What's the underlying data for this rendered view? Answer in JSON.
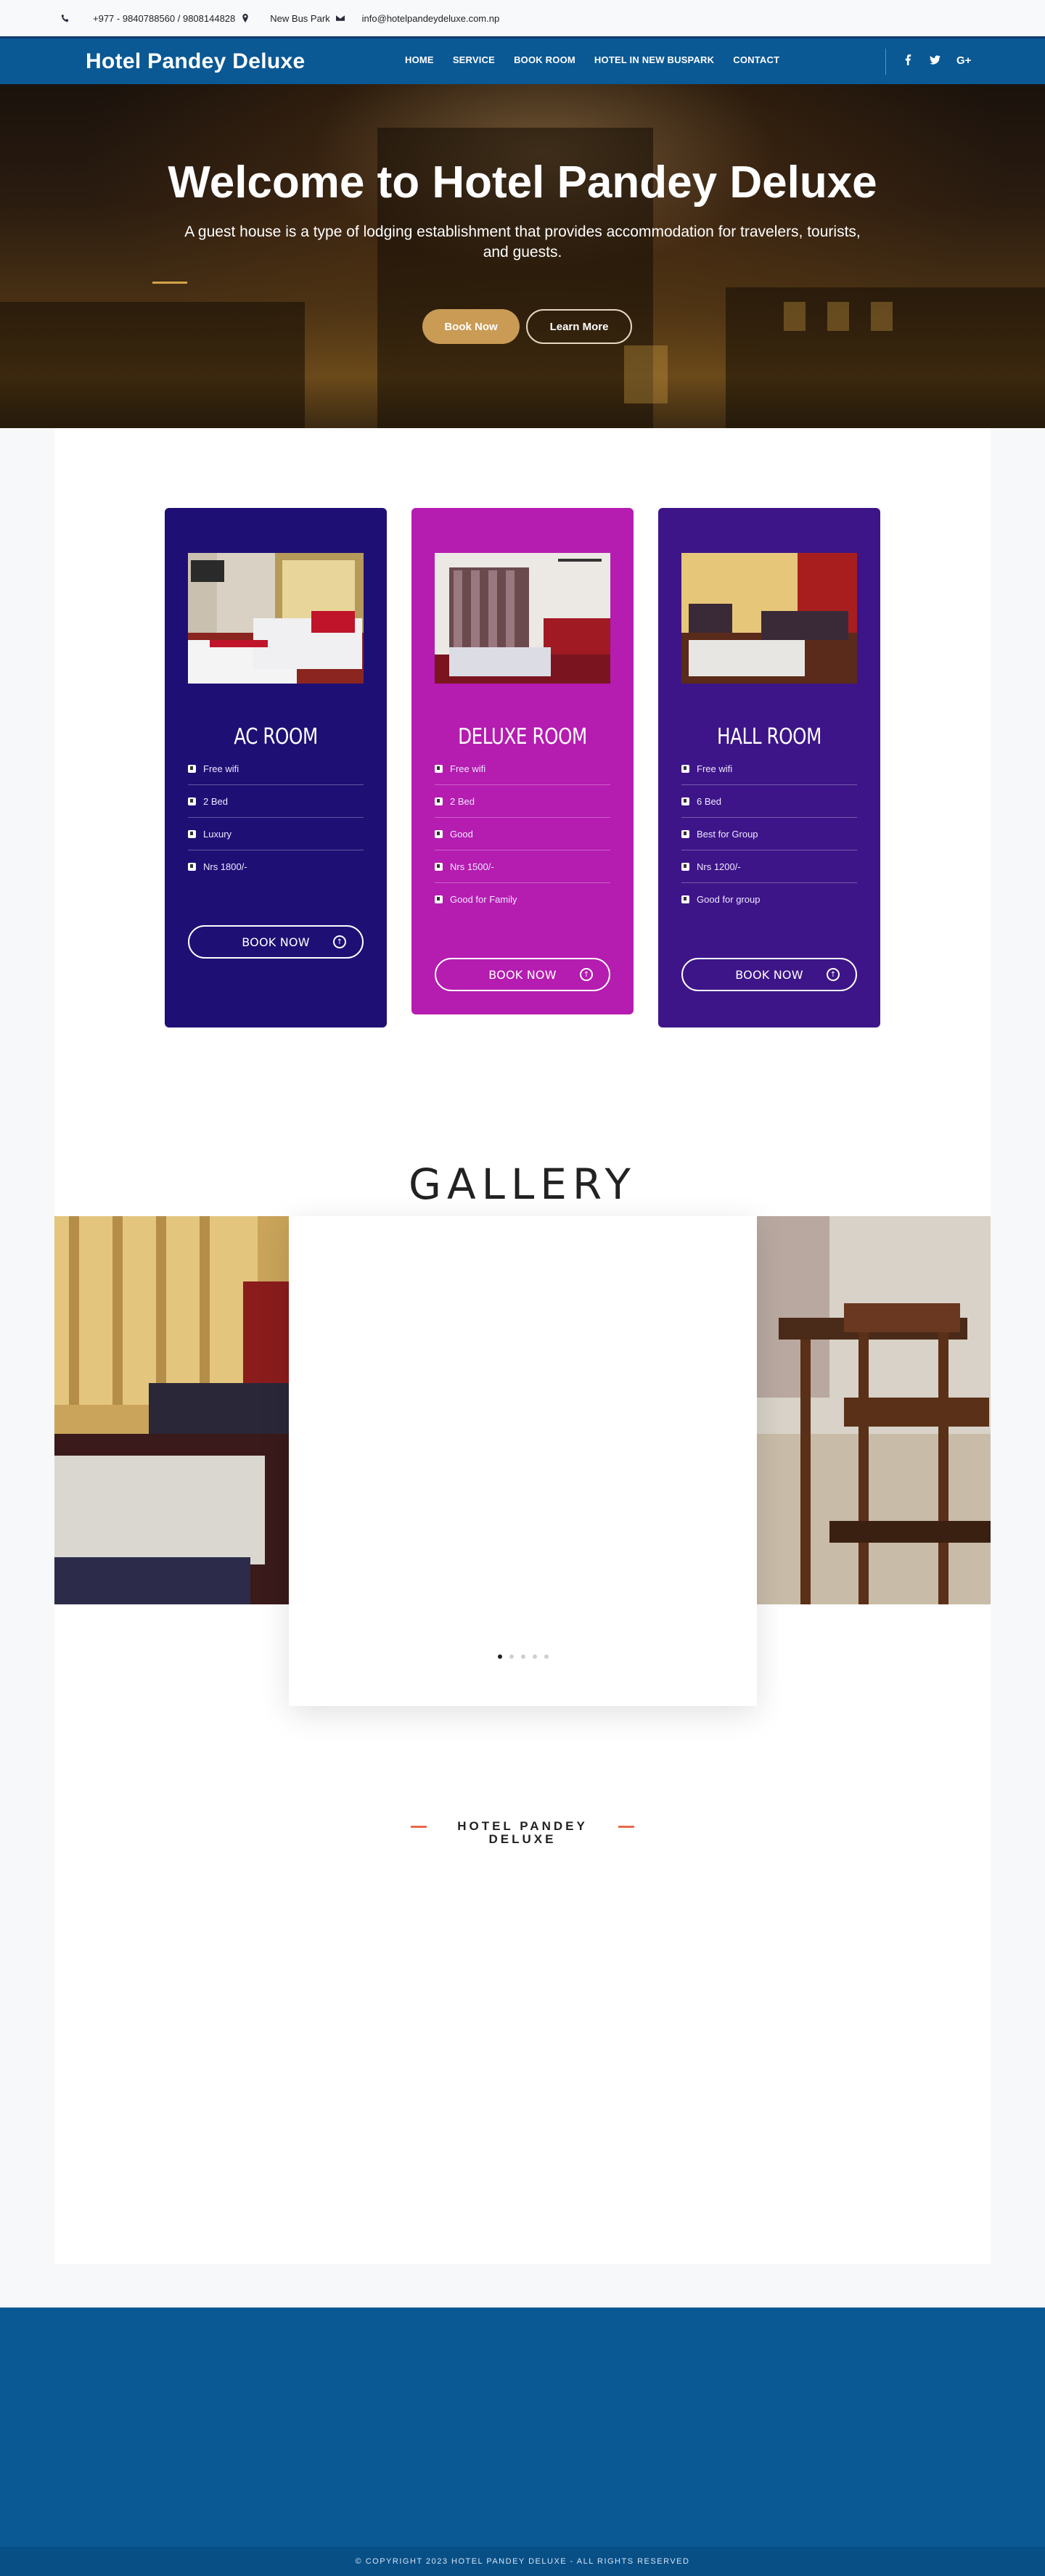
{
  "topbar": {
    "phone": "+977 - 9840788560 / 9808144828",
    "location": "New Bus Park",
    "email": "info@hotelpandeydeluxe.com.np"
  },
  "nav": {
    "brand": "Hotel Pandey Deluxe",
    "items": [
      "HOME",
      "SERVICE",
      "BOOK ROOM",
      "HOTEL IN NEW BUSPARK",
      "CONTACT"
    ],
    "google_plus": "G+"
  },
  "hero": {
    "title": "Welcome to Hotel Pandey Deluxe",
    "subtitle": "A guest house is a type of lodging establishment that provides accommodation for travelers, tourists, and guests.",
    "book_label": "Book Now",
    "learn_label": "Learn More"
  },
  "rooms": [
    {
      "name": "AC ROOM",
      "color": "#1e0f75",
      "features": [
        "Free wifi",
        "2 Bed",
        "Luxury",
        "Nrs 1800/-"
      ],
      "button": "BOOK NOW"
    },
    {
      "name": "DELUXE ROOM",
      "color": "#b51cb0",
      "features": [
        "Free wifi",
        "2 Bed",
        "Good",
        "Nrs 1500/-",
        "Good for Family"
      ],
      "button": "BOOK NOW"
    },
    {
      "name": "HALL ROOM",
      "color": "#3d1588",
      "features": [
        "Free wifi",
        "6 Bed",
        "Best for Group",
        "Nrs 1200/-",
        "Good for group"
      ],
      "button": "BOOK NOW"
    }
  ],
  "gallery": {
    "title": "GALLERY",
    "slide_count": 5,
    "active_slide": 1
  },
  "section": {
    "heading_line1": "HOTEL PANDEY",
    "heading_line2": "DELUXE"
  },
  "footer": {
    "copyright": "© COPYRIGHT 2023 HOTEL PANDEY DELUXE - ALL RIGHTS RESERVED"
  },
  "colors": {
    "nav": "#0a5894",
    "accent_gold": "#c99b55",
    "heading_line": "#e86a4a"
  }
}
